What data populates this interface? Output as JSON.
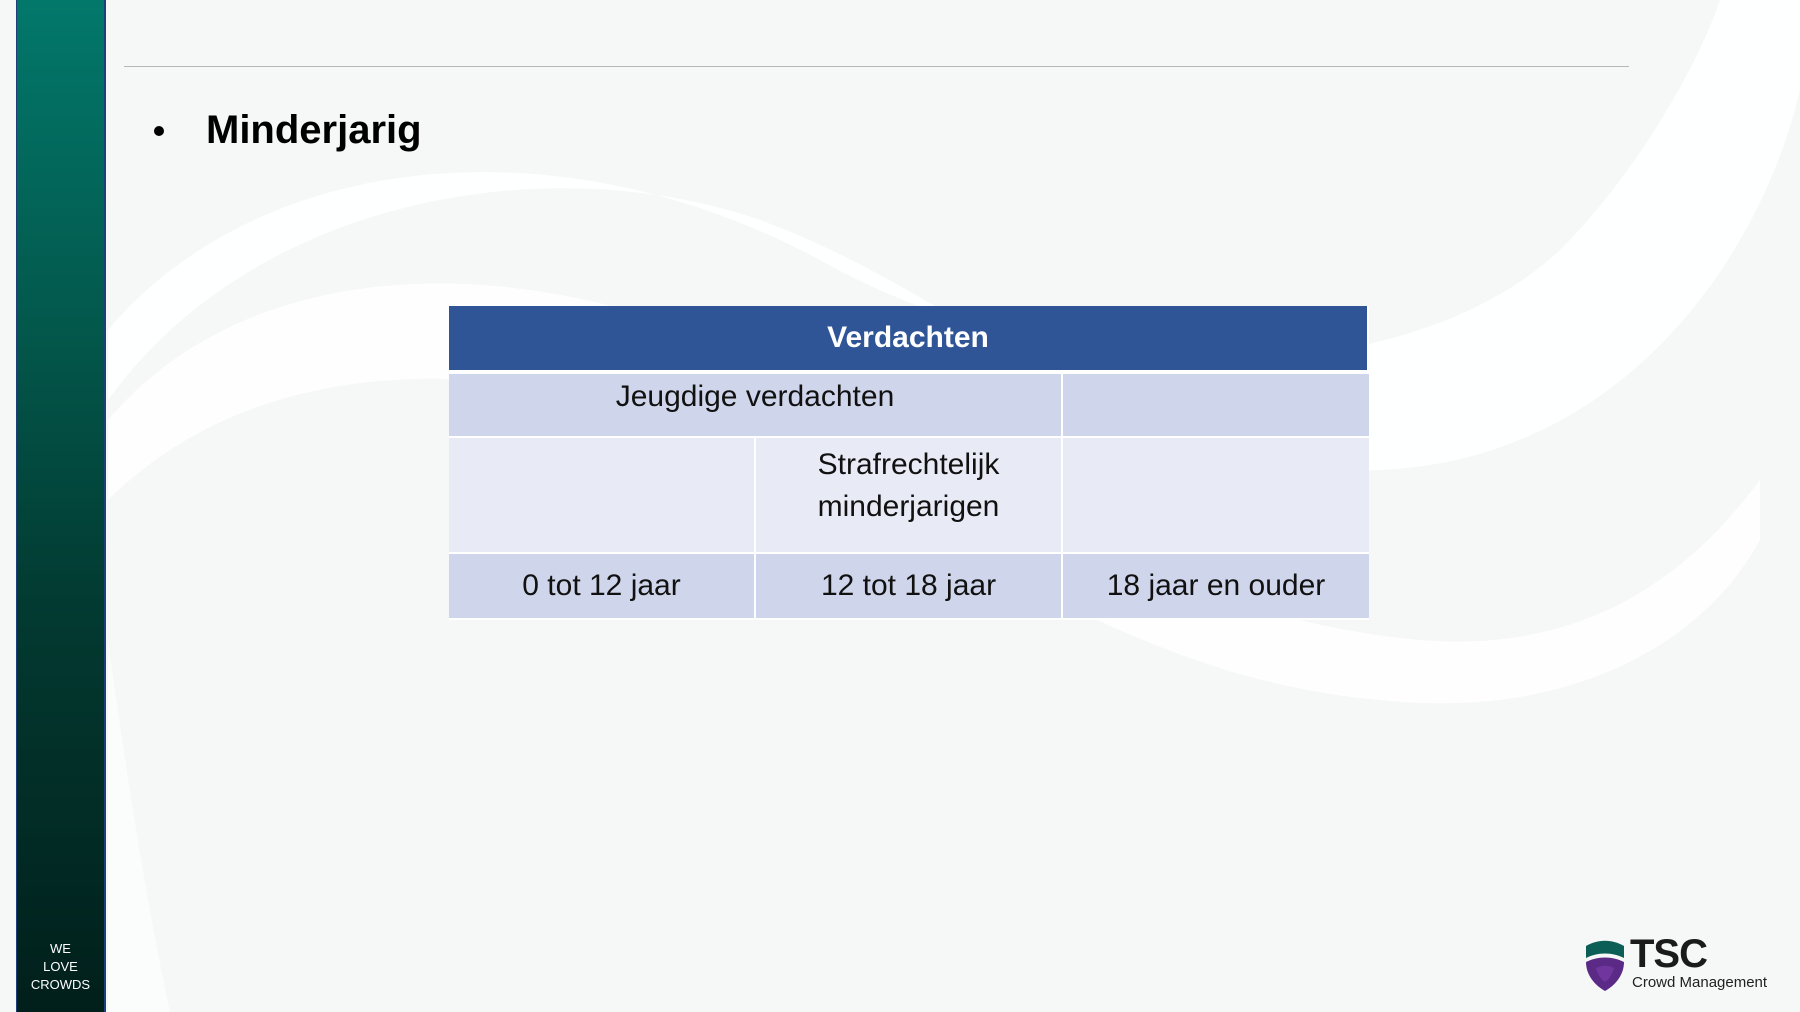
{
  "slide": {
    "bullet": "Minderjarig",
    "sidebar_slogan": [
      "WE",
      "LOVE",
      "CROWDS"
    ]
  },
  "table": {
    "header": "Verdachten",
    "row1": {
      "c1": "Jeugdige verdachten",
      "c2": ""
    },
    "row2": {
      "c1": "",
      "c2": "Strafrechtelijk minderjarigen",
      "c3": ""
    },
    "row3": {
      "c1": "0 tot 12 jaar",
      "c2": "12 tot 18 jaar",
      "c3": "18 jaar en ouder"
    }
  },
  "logo": {
    "name": "TSC",
    "subtitle": "Crowd Management"
  },
  "colors": {
    "header_blue": "#2f5597",
    "row_dark": "#cfd5ea",
    "row_light": "#e8ebf5",
    "sidebar_teal": "#02786b",
    "logo_teal": "#0b5f56",
    "logo_purple": "#5b2a86"
  }
}
